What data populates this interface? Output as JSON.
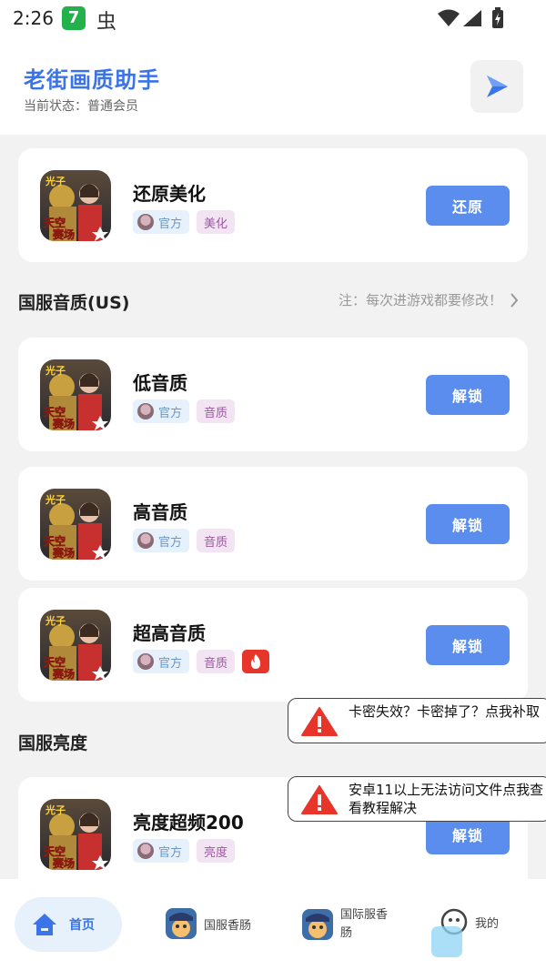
{
  "status_bar": {
    "time": "2:26",
    "app1_glyph": "7",
    "app2_glyph": "虫"
  },
  "header": {
    "title": "老街画质助手",
    "status": "当前状态：普通会员"
  },
  "cards": [
    {
      "title": "还原美化",
      "tag_official": "官方",
      "tag_category": "美化",
      "button": "还原",
      "hot": false
    },
    {
      "title": "低音质",
      "tag_official": "官方",
      "tag_category": "音质",
      "button": "解锁",
      "hot": false
    },
    {
      "title": "高音质",
      "tag_official": "官方",
      "tag_category": "音质",
      "button": "解锁",
      "hot": false
    },
    {
      "title": "超高音质",
      "tag_official": "官方",
      "tag_category": "音质",
      "button": "解锁",
      "hot": true
    },
    {
      "title": "亮度超频200",
      "tag_official": "官方",
      "tag_category": "亮度",
      "button": "解锁",
      "hot": false
    }
  ],
  "sections": [
    {
      "title": "国服音质(US)",
      "note": "注：每次进游戏都要修改！"
    },
    {
      "title": "国服亮度"
    }
  ],
  "toasts": [
    {
      "text": "卡密失效？卡密掉了？点我补取"
    },
    {
      "text": "安卓11以上无法访问文件点我查看教程解决"
    }
  ],
  "bottom_nav": {
    "home": "首页",
    "cn_sausage": "国服香肠",
    "intl_sausage": "国际服香肠",
    "mine": "我的"
  },
  "icons": {
    "play": "play-icon",
    "home": "home-icon",
    "warning": "warning-icon",
    "fire": "fire-icon",
    "chevron": "chevron-right-icon",
    "smile": "smile-icon"
  },
  "colors": {
    "accent": "#3a74e8",
    "button": "#5b8def",
    "hot": "#e8352a"
  }
}
